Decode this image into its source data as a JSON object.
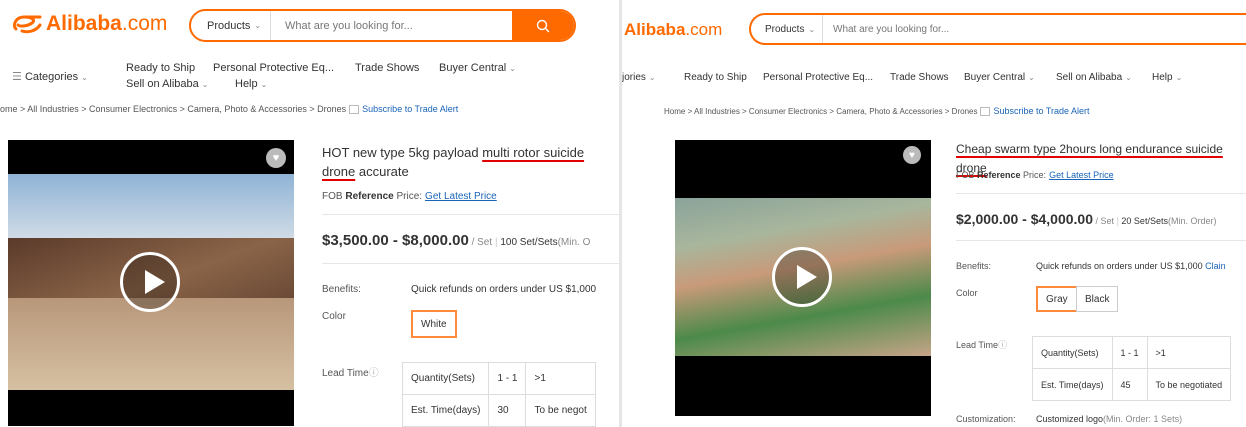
{
  "left": {
    "logo": {
      "brand": "Alibaba",
      "domain": ".com"
    },
    "search": {
      "category_label": "Products",
      "placeholder": "What are you looking for..."
    },
    "nav": {
      "categories": "Categories",
      "ready_to_ship": "Ready to Ship",
      "ppe": "Personal Protective Eq...",
      "trade_shows": "Trade Shows",
      "buyer_central": "Buyer Central",
      "sell_on_alibaba": "Sell on Alibaba",
      "help": "Help"
    },
    "breadcrumb": {
      "path": "ome > All Industries > Consumer Electronics > Camera, Photo & Accessories > Drones",
      "alert": "Subscribe to Trade Alert"
    },
    "product": {
      "title_part1": "HOT new type 5kg payload ",
      "title_highlight": "multi rotor suicide drone",
      "title_part2": " accurate",
      "fob_prefix": "FOB ",
      "fob_bold": "Reference",
      "fob_suffix": " Price:",
      "fob_link": "Get Latest Price",
      "price": "$3,500.00 - $8,000.00",
      "price_unit": "/ Set",
      "moq": "100 Set/Sets",
      "moq_note": "(Min. O",
      "benefits_label": "Benefits:",
      "benefits_value": "Quick refunds on orders under US $1,000",
      "color_label": "Color",
      "color_options": [
        "White"
      ],
      "lead_time_label": "Lead Time",
      "lead_table": {
        "row1": [
          "Quantity(Sets)",
          "1 - 1",
          ">1"
        ],
        "row2": [
          "Est. Time(days)",
          "30",
          "To be negot"
        ]
      }
    }
  },
  "right": {
    "logo": {
      "brand": "Alibaba",
      "domain": ".com"
    },
    "search": {
      "category_label": "Products",
      "placeholder": "What are you looking for..."
    },
    "nav": {
      "categories_cut": "jories",
      "ready_to_ship": "Ready to Ship",
      "ppe": "Personal Protective Eq...",
      "trade_shows": "Trade Shows",
      "buyer_central": "Buyer Central",
      "sell_on_alibaba": "Sell on Alibaba",
      "help": "Help"
    },
    "breadcrumb": {
      "path": "Home > All Industries > Consumer Electronics > Camera, Photo & Accessories > Drones",
      "alert": "Subscribe to Trade Alert"
    },
    "product": {
      "title_highlight": "Cheap swarm type 2hours long endurance suicide drone",
      "fob_prefix": "FOB ",
      "fob_bold": "Reference",
      "fob_suffix": " Price:",
      "fob_link": "Get Latest Price",
      "price": "$2,000.00 - $4,000.00",
      "price_unit": "/ Set",
      "moq": "20 Set/Sets",
      "moq_note": "(Min. Order)",
      "benefits_label": "Benefits:",
      "benefits_value": "Quick refunds on orders under US $1,000",
      "benefits_link": "Clain",
      "color_label": "Color",
      "color_options": [
        "Gray",
        "Black"
      ],
      "lead_time_label": "Lead Time",
      "lead_table": {
        "row1": [
          "Quantity(Sets)",
          "1 - 1",
          ">1"
        ],
        "row2": [
          "Est. Time(days)",
          "45",
          "To be negotiated"
        ]
      },
      "customization_label": "Customization:",
      "customization_value": "Customized logo",
      "customization_note": "(Min. Order: 1 Sets)"
    }
  },
  "colors": {
    "accent": "#ff6a00",
    "link": "#1a64b8",
    "highlight_underline": "#e00000"
  }
}
